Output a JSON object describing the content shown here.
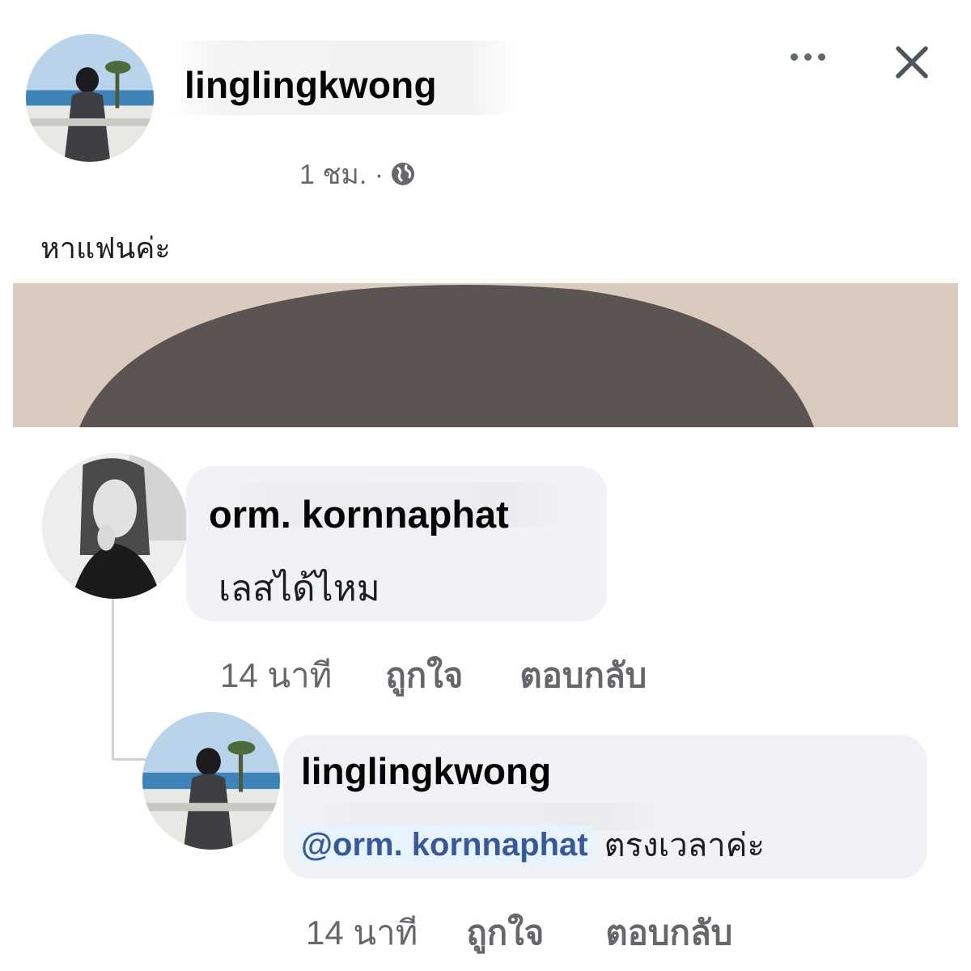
{
  "post": {
    "author": "linglingkwong",
    "time": "1 ชม. ·",
    "privacy_icon": "globe-icon",
    "text": "หาแฟนค่ะ"
  },
  "header_controls": {
    "more_icon": "more-horizontal-icon",
    "close_icon": "close-icon"
  },
  "comment": {
    "author": "orm. kornnaphat",
    "text": "เลสได้ไหม",
    "time": "14 นาที",
    "like_label": "ถูกใจ",
    "reply_label": "ตอบกลับ"
  },
  "reply": {
    "author": "linglingkwong",
    "mention": "@orm. kornnaphat",
    "text": "ตรงเวลาค่ะ",
    "time": "14 นาที",
    "like_label": "ถูกใจ",
    "reply_label": "ตอบกลับ"
  },
  "colors": {
    "mention": "#385898",
    "meta_text": "#65676b",
    "bubble": "#f0f2f5",
    "image_bg": "#d8cbbd",
    "image_shape": "#5b5452"
  }
}
